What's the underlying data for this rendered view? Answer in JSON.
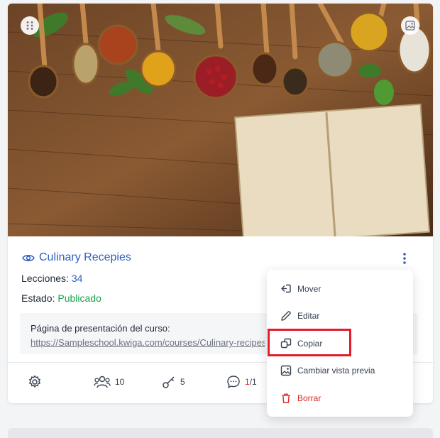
{
  "course": {
    "title": "Culinary Recepies",
    "lessons_label": "Lecciones:",
    "lessons_count": "34",
    "status_label": "Estado:",
    "status_value": "Publicado",
    "presentation_label": "Página de presentación del curso:",
    "presentation_url": "https://Sampleschool.kwiga.com/courses/Culinary-recipes"
  },
  "footer": {
    "students_count": "10",
    "keys_count": "5",
    "comments_new": "1",
    "comments_sep_total": "/1"
  },
  "context_menu": {
    "items": [
      {
        "label": "Mover",
        "icon": "move-icon"
      },
      {
        "label": "Editar",
        "icon": "pencil-icon"
      },
      {
        "label": "Copiar",
        "icon": "copy-icon"
      },
      {
        "label": "Cambiar vista previa",
        "icon": "image-icon"
      },
      {
        "label": "Borrar",
        "icon": "trash-icon"
      }
    ],
    "highlighted": "Copiar"
  },
  "colors": {
    "link_blue": "#2f5fbf",
    "published_green": "#16a34a",
    "danger_red": "#dc2626",
    "highlight_border": "#e11d2b"
  }
}
